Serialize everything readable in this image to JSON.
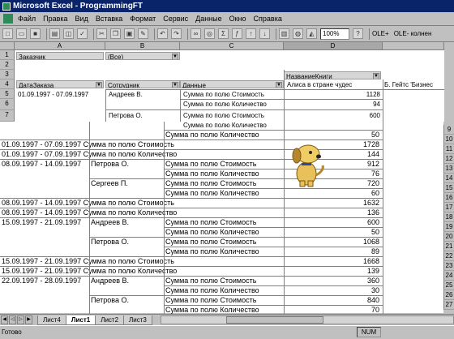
{
  "window": {
    "title": "Microsoft Excel - ProgrammingFT"
  },
  "menu": [
    "Файл",
    "Правка",
    "Вид",
    "Вставка",
    "Формат",
    "Сервис",
    "Данные",
    "Окно",
    "Справка"
  ],
  "toolbar": {
    "zoom": "100%",
    "olap1": "OLE+",
    "olap2": "OLE- колнен"
  },
  "columns": {
    "a": "A",
    "b": "B",
    "c": "C",
    "d": "D"
  },
  "pivot": {
    "r1_label": "Заказчик",
    "r1_value": "(Все)",
    "r3_d": "НазваниеКниги",
    "r4_a": "ДатаЗаказа",
    "r4_b": "Сотрудник",
    "r4_c": "Данные",
    "r4_d": "Алиса в стране чудес",
    "r4_e": "Б. Гейтс 'Бизнес",
    "r5_a": "01.09.1997 - 07.09.1997",
    "r5_b": "Андреев В.",
    "r5_c": "Сумма по полю Стоимость",
    "r5_d": "1128",
    "r6_c": "Сумма по полю Количество",
    "r6_d": "94",
    "r7_b": "Петрова О.",
    "r7_c": "Сумма по полю Стоимость",
    "r7_d": "600",
    "r8_c": "Сумма по полю Количество"
  },
  "rows_top": [
    "1",
    "2",
    "3",
    "4",
    "5",
    "6",
    "7"
  ],
  "rows_right": [
    "9",
    "10",
    "11",
    "12",
    "13",
    "14",
    "15",
    "16",
    "17",
    "18",
    "19",
    "20",
    "21",
    "22",
    "23",
    "24",
    "25",
    "26",
    "27"
  ],
  "sheet_rows": [
    {
      "a": "",
      "b": "",
      "c": "Сумма по полю Количество",
      "d": "50"
    },
    {
      "a": "01.09.1997 - 07.09.1997 Сумма по полю Стоимость",
      "b": "",
      "c": "",
      "d": "1728"
    },
    {
      "a": "01.09.1997 - 07.09.1997 Сумма по полю Количество",
      "b": "",
      "c": "",
      "d": "144"
    },
    {
      "a": "08.09.1997 - 14.09.1997",
      "b": "Петрова О.",
      "c": "Сумма по полю Стоимость",
      "d": "912"
    },
    {
      "a": "",
      "b": "",
      "c": "Сумма по полю Количество",
      "d": "76"
    },
    {
      "a": "",
      "b": "Сергеев П.",
      "c": "Сумма по полю Стоимость",
      "d": "720"
    },
    {
      "a": "",
      "b": "",
      "c": "Сумма по полю Количество",
      "d": "60"
    },
    {
      "a": "08.09.1997 - 14.09.1997 Сумма по полю Стоимость",
      "b": "",
      "c": "",
      "d": "1632"
    },
    {
      "a": "08.09.1997 - 14.09.1997 Сумма по полю Количество",
      "b": "",
      "c": "",
      "d": "136"
    },
    {
      "a": "15.09.1997 - 21.09.1997",
      "b": "Андреев В.",
      "c": "Сумма по полю Стоимость",
      "d": "600"
    },
    {
      "a": "",
      "b": "",
      "c": "Сумма по полю Количество",
      "d": "50"
    },
    {
      "a": "",
      "b": "Петрова О.",
      "c": "Сумма по полю Стоимость",
      "d": "1068"
    },
    {
      "a": "",
      "b": "",
      "c": "Сумма по полю Количество",
      "d": "89"
    },
    {
      "a": "15.09.1997 - 21.09.1997 Сумма по полю Стоимость",
      "b": "",
      "c": "",
      "d": "1668"
    },
    {
      "a": "15.09.1997 - 21.09.1997 Сумма по полю Количество",
      "b": "",
      "c": "",
      "d": "139"
    },
    {
      "a": "22.09.1997 - 28.09.1997",
      "b": "Андреев В.",
      "c": "Сумма по полю Стоимость",
      "d": "360"
    },
    {
      "a": "",
      "b": "",
      "c": "Сумма по полю Количество",
      "d": "30"
    },
    {
      "a": "",
      "b": "Петрова О.",
      "c": "Сумма по полю Стоимость",
      "d": "840"
    },
    {
      "a": "",
      "b": "",
      "c": "Сумма по полю Количество",
      "d": "70"
    }
  ],
  "tabs": [
    "Лист4",
    "Лист1",
    "Лист2",
    "Лист3"
  ],
  "status": {
    "left": "Готово",
    "num": "NUM"
  }
}
